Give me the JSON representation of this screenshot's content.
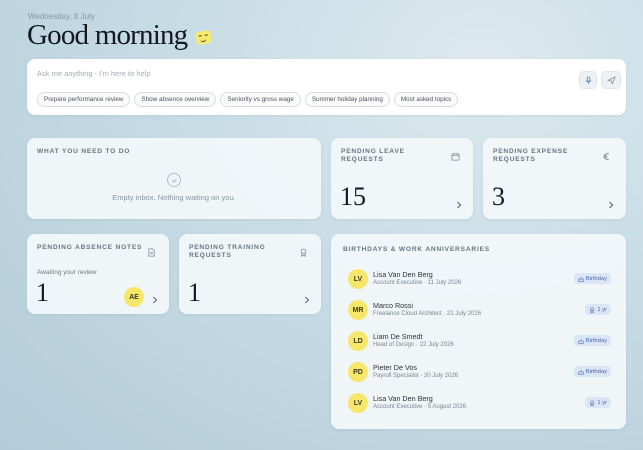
{
  "header": {
    "date": "Wednesday, 8 July",
    "greeting": "Good morning"
  },
  "ask": {
    "placeholder": "Ask me anything - I'm here to help",
    "chips": [
      "Prepare performance review",
      "Show absence overview",
      "Seniority vs gross wage",
      "Summer holiday planning",
      "Most asked topics"
    ],
    "mic_icon": "microphone-icon",
    "send_icon": "send-icon"
  },
  "todo": {
    "title": "WHAT YOU NEED TO DO",
    "empty_text": "Empty inbox. Nothing waiting on you.",
    "icon": "check-circle-icon"
  },
  "leave": {
    "title": "PENDING LEAVE REQUESTS",
    "count": "15",
    "icon": "calendar-icon"
  },
  "expense": {
    "title": "PENDING EXPENSE REQUESTS",
    "count": "3",
    "icon": "euro-icon"
  },
  "absence": {
    "title": "PENDING ABSENCE NOTES",
    "subtitle": "Awaiting your review",
    "count": "1",
    "avatar": "AE",
    "icon": "document-icon"
  },
  "training": {
    "title": "PENDING TRAINING REQUESTS",
    "count": "1",
    "icon": "award-icon"
  },
  "birthdays": {
    "title": "BIRTHDAYS & WORK ANNIVERSARIES",
    "items": [
      {
        "initials": "LV",
        "name": "Lisa Van Den Berg",
        "sub": "Account Executive · 11 July 2026",
        "badge": "Birthday",
        "badge_icon": "cake-icon"
      },
      {
        "initials": "MR",
        "name": "Marco Rossi",
        "sub": "Freelance Cloud Architect · 21 July 2026",
        "badge": "1 yr",
        "badge_icon": "award-icon"
      },
      {
        "initials": "LD",
        "name": "Liam De Smedt",
        "sub": "Head of Design · 22 July 2026",
        "badge": "Birthday",
        "badge_icon": "cake-icon"
      },
      {
        "initials": "PD",
        "name": "Pieter De Vos",
        "sub": "Payroll Specialist · 30 July 2026",
        "badge": "Birthday",
        "badge_icon": "cake-icon"
      },
      {
        "initials": "LV",
        "name": "Lisa Van Den Berg",
        "sub": "Account Executive · 5 August 2026",
        "badge": "1 yr",
        "badge_icon": "award-icon"
      }
    ]
  },
  "colors": {
    "accent_yellow": "#f6e76a",
    "badge_bg": "#dbe5f6",
    "badge_text": "#4a67a8"
  }
}
